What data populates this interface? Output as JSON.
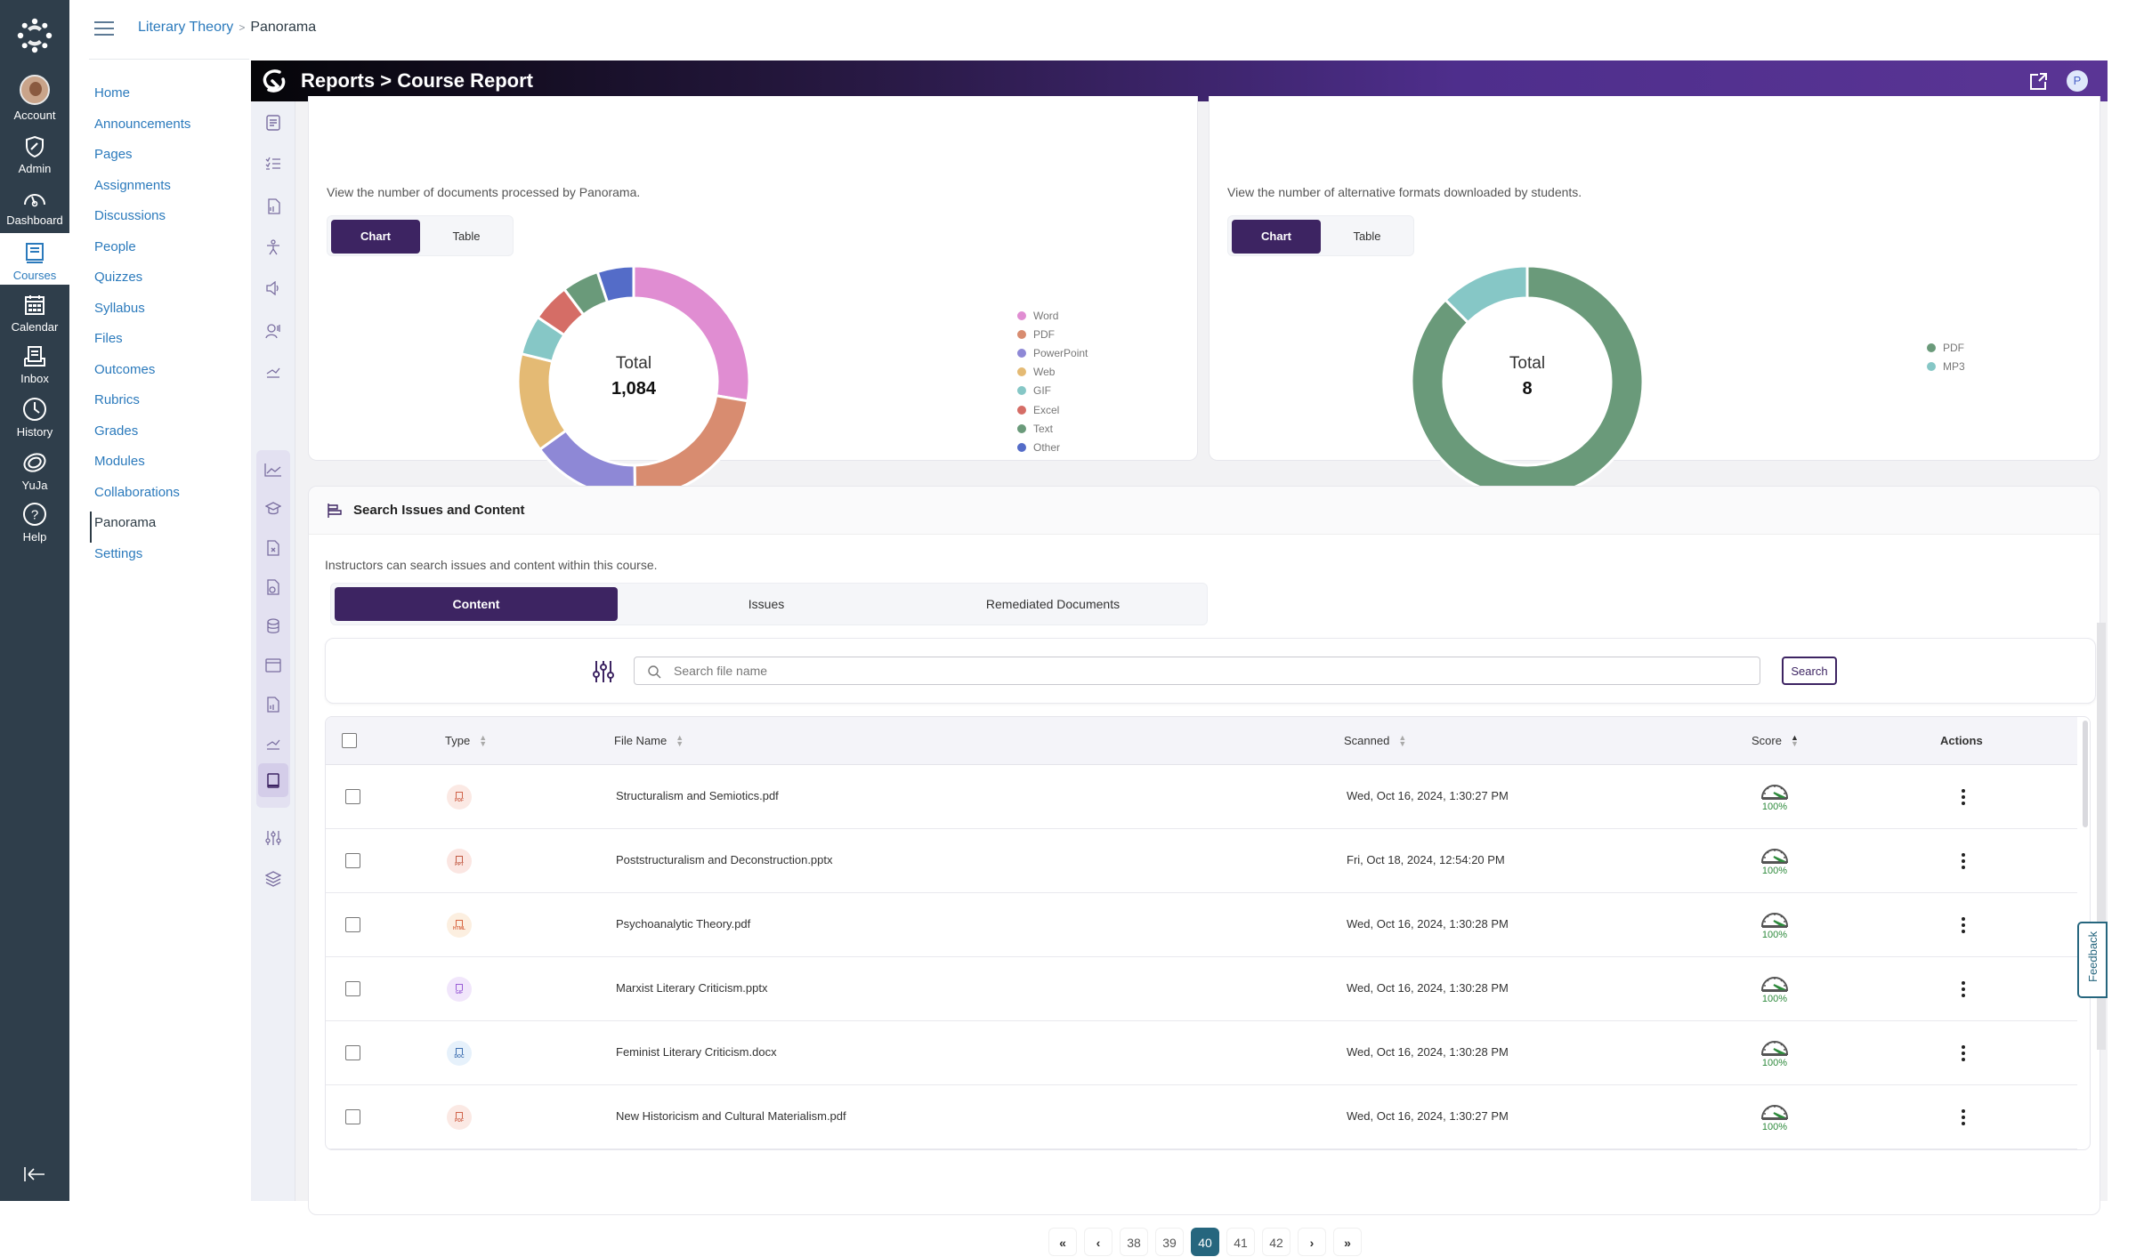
{
  "global_nav": {
    "items": [
      {
        "label": "Account",
        "icon": "avatar"
      },
      {
        "label": "Admin",
        "icon": "shield-wrench-icon"
      },
      {
        "label": "Dashboard",
        "icon": "dashboard-gauge-icon"
      },
      {
        "label": "Courses",
        "icon": "book-icon",
        "active": true
      },
      {
        "label": "Calendar",
        "icon": "calendar-icon"
      },
      {
        "label": "Inbox",
        "icon": "inbox-icon"
      },
      {
        "label": "History",
        "icon": "clock-icon"
      },
      {
        "label": "YuJa",
        "icon": "yuja-icon"
      },
      {
        "label": "Help",
        "icon": "help-circle-icon"
      }
    ],
    "collapse_icon": "collapse-left-icon"
  },
  "breadcrumb": {
    "course": "Literary Theory",
    "current": "Panorama"
  },
  "course_nav": {
    "items": [
      "Home",
      "Announcements",
      "Pages",
      "Assignments",
      "Discussions",
      "People",
      "Quizzes",
      "Syllabus",
      "Files",
      "Outcomes",
      "Rubrics",
      "Grades",
      "Modules",
      "Collaborations",
      "Panorama",
      "Settings"
    ],
    "active": "Panorama"
  },
  "panorama": {
    "title": "Reports > Course Report",
    "avatar_initial": "P",
    "colors": {
      "brand_dark": "#3d2462",
      "header_end": "#5a3595",
      "page_active": "#26667e",
      "score_green": "#2e8a3c"
    }
  },
  "documents_card": {
    "description": "View the number of documents processed by Panorama.",
    "toggle": [
      "Chart",
      "Table"
    ],
    "active_toggle": "Chart",
    "center_label": "Total",
    "center_value": "1,084"
  },
  "alt_formats_card": {
    "description": "View the number of alternative formats downloaded by students.",
    "toggle": [
      "Chart",
      "Table"
    ],
    "active_toggle": "Chart",
    "center_label": "Total",
    "center_value": "8"
  },
  "chart_data": [
    {
      "type": "pie",
      "subtype": "donut",
      "title": "Documents processed by Panorama",
      "total": 1084,
      "categories": [
        "Word",
        "PDF",
        "PowerPoint",
        "Web",
        "GIF",
        "Excel",
        "Text",
        "Other"
      ],
      "values": [
        300,
        240,
        165,
        150,
        60,
        58,
        56,
        55
      ],
      "colors": [
        "#e08dd2",
        "#d88c70",
        "#8e88d6",
        "#e4ba74",
        "#86c7c6",
        "#d56d66",
        "#6a9a7a",
        "#546cc8"
      ],
      "legend": "right"
    },
    {
      "type": "pie",
      "subtype": "donut",
      "title": "Alternative formats downloaded by students",
      "total": 8,
      "categories": [
        "PDF",
        "MP3"
      ],
      "values": [
        7,
        1
      ],
      "colors": [
        "#6a9a7a",
        "#86c7c6"
      ],
      "legend": "right"
    }
  ],
  "search_section": {
    "title": "Search Issues and Content",
    "description": "Instructors can search issues and content within this course.",
    "tabs": [
      "Content",
      "Issues",
      "Remediated Documents"
    ],
    "active_tab": "Content",
    "search_placeholder": "Search file name",
    "search_value": "",
    "search_button": "Search"
  },
  "table": {
    "columns": [
      "Type",
      "File Name",
      "Scanned",
      "Score",
      "Actions"
    ],
    "rows": [
      {
        "type": "PDF",
        "file_name": "Structuralism and Semiotics.pdf",
        "scanned": "Wed, Oct 16, 2024, 1:30:27 PM",
        "score": "100%"
      },
      {
        "type": "PPT",
        "file_name": "Poststructuralism and Deconstruction.pptx",
        "scanned": "Fri, Oct 18, 2024, 12:54:20 PM",
        "score": "100%"
      },
      {
        "type": "HTML",
        "file_name": "Psychoanalytic Theory.pdf",
        "scanned": "Wed, Oct 16, 2024, 1:30:28 PM",
        "score": "100%"
      },
      {
        "type": "GIF",
        "file_name": "Marxist Literary Criticism.pptx",
        "scanned": "Wed, Oct 16, 2024, 1:30:28 PM",
        "score": "100%"
      },
      {
        "type": "DOC",
        "file_name": "Feminist Literary Criticism.docx",
        "scanned": "Wed, Oct 16, 2024, 1:30:28 PM",
        "score": "100%"
      },
      {
        "type": "PDF",
        "file_name": "New Historicism and Cultural Materialism.pdf",
        "scanned": "Wed, Oct 16, 2024, 1:30:27 PM",
        "score": "100%"
      }
    ]
  },
  "pagination": {
    "first": "«",
    "prev": "‹",
    "next": "›",
    "last": "»",
    "pages": [
      "38",
      "39",
      "40",
      "41",
      "42"
    ],
    "current": "40"
  },
  "feedback_tab": "Feedback"
}
